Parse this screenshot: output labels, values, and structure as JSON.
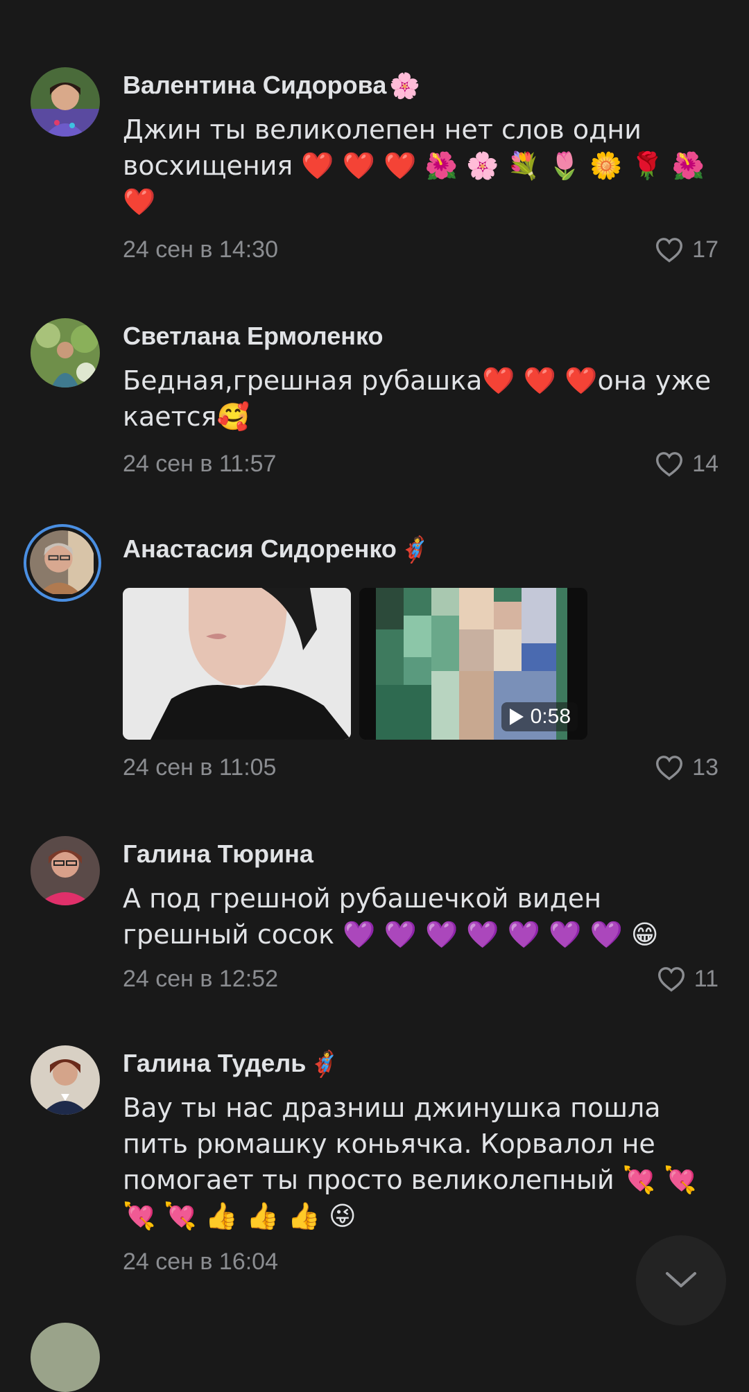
{
  "comments": [
    {
      "author": "Валентина Сидорова",
      "badge": "🌸",
      "text": "Джин ты великолепен нет слов одни восхищения ❤️ ❤️ ❤️ 🌺 🌸 💐 🌷 🌼 🌹 🌺 ❤️",
      "date": "24 сен в 14:30",
      "likes": "17"
    },
    {
      "author": "Светлана Ермоленко",
      "badge": "",
      "text": "Бедная,грешная рубашка❤️ ❤️ ❤️она уже кается🥰",
      "date": "24 сен в 11:57",
      "likes": "14"
    },
    {
      "author": "Анастасия Сидоренко",
      "badge": "🦸",
      "attachments": {
        "video_duration": "0:58"
      },
      "date": "24 сен в 11:05",
      "likes": "13"
    },
    {
      "author": "Галина Тюрина",
      "badge": "",
      "text": "А под грешной рубашечкой виден грешный сосок 💜 💜 💜 💜 💜 💜 💜 😁",
      "date": "24 сен в 12:52",
      "likes": "11"
    },
    {
      "author": "Галина Тудель",
      "badge": "🦸",
      "text": "Вау ты нас дразниш   джинушка пошла пить рюмашку коньячка. Корвалол не помогает ты просто великолепный  💘 💘 💘 💘 👍 👍 👍 😜",
      "date": "24 сен в 16:04"
    }
  ],
  "icons": {
    "like": "heart-outline-icon",
    "scroll_down": "chevron-down-icon",
    "play": "play-icon"
  },
  "colors": {
    "background": "#191919",
    "text_primary": "#e1e3e6",
    "text_secondary": "#8b8d91",
    "story_ring": "#4a8fe2"
  }
}
